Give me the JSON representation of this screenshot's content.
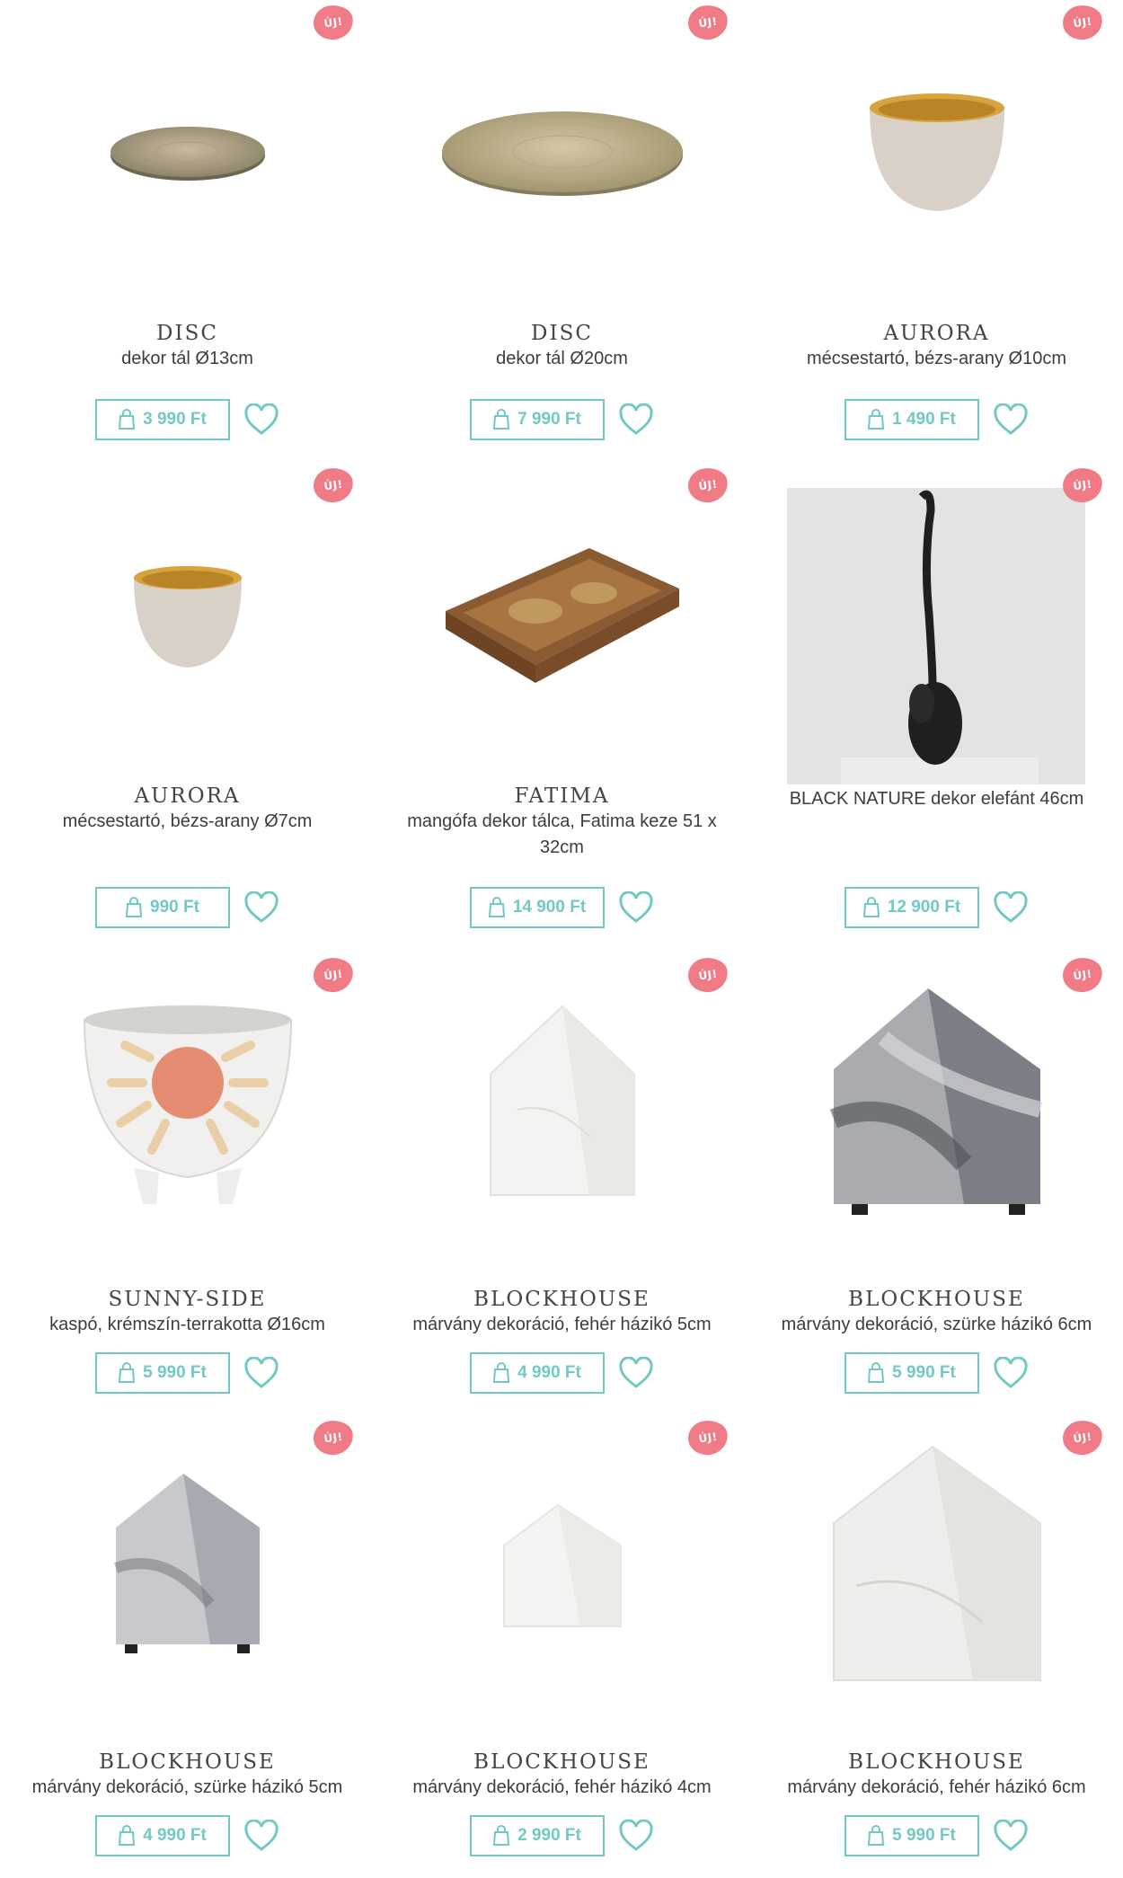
{
  "badge_text": "ÚJ!",
  "accent_color": "#72c9c4",
  "badge_color": "#f07b87",
  "icons": {
    "price": "shopping-bag-icon",
    "wishlist": "heart-icon"
  },
  "products": [
    {
      "name": "DISC",
      "desc": "dekor tál Ø13cm",
      "price": "3 990 Ft",
      "new": true
    },
    {
      "name": "DISC",
      "desc": "dekor tál Ø20cm",
      "price": "7 990 Ft",
      "new": true
    },
    {
      "name": "AURORA",
      "desc": "mécsestartó, bézs-arany Ø10cm",
      "price": "1 490 Ft",
      "new": true
    },
    {
      "name": "AURORA",
      "desc": "mécsestartó, bézs-arany Ø7cm",
      "price": "990 Ft",
      "new": true
    },
    {
      "name": "FATIMA",
      "desc": "mangófa dekor tálca, Fatima keze 51 x 32cm",
      "price": "14 900 Ft",
      "new": true
    },
    {
      "name": "",
      "desc": "BLACK NATURE dekor elefánt 46cm",
      "price": "12 900 Ft",
      "new": true
    },
    {
      "name": "SUNNY-SIDE",
      "desc": "kaspó, krémszín-terrakotta Ø16cm",
      "price": "5 990 Ft",
      "new": true
    },
    {
      "name": "BLOCKHOUSE",
      "desc": "márvány dekoráció, fehér házikó 5cm",
      "price": "4 990 Ft",
      "new": true
    },
    {
      "name": "BLOCKHOUSE",
      "desc": "márvány dekoráció, szürke házikó 6cm",
      "price": "5 990 Ft",
      "new": true
    },
    {
      "name": "BLOCKHOUSE",
      "desc": "márvány dekoráció, szürke házikó 5cm",
      "price": "4 990 Ft",
      "new": true
    },
    {
      "name": "BLOCKHOUSE",
      "desc": "márvány dekoráció, fehér házikó 4cm",
      "price": "2 990 Ft",
      "new": true
    },
    {
      "name": "BLOCKHOUSE",
      "desc": "márvány dekoráció, fehér házikó 6cm",
      "price": "5 990 Ft",
      "new": true
    }
  ]
}
